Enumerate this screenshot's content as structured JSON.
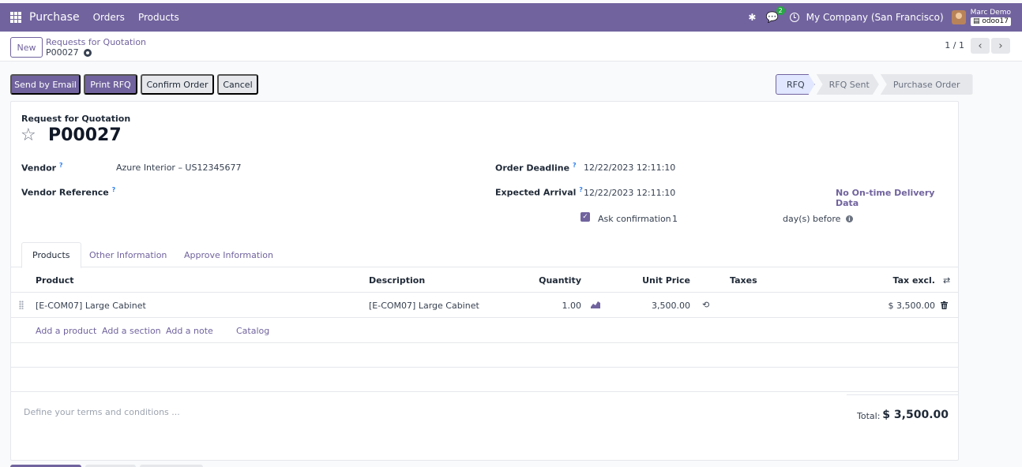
{
  "topnav": {
    "app_name": "Purchase",
    "menu": [
      "Orders",
      "Products"
    ],
    "chat_count": "2",
    "company": "My Company (San Francisco)",
    "user_name": "Marc Demo",
    "db_name": "odoo17"
  },
  "control": {
    "new_label": "New",
    "breadcrumb": "Requests for Quotation",
    "record": "P00027",
    "pager": "1 / 1"
  },
  "actions": {
    "send_email": "Send by Email",
    "print_rfq": "Print RFQ",
    "confirm_order": "Confirm Order",
    "cancel": "Cancel"
  },
  "statusbar": [
    "RFQ",
    "RFQ Sent",
    "Purchase Order"
  ],
  "form": {
    "doc_type": "Request for Quotation",
    "doc_name": "P00027",
    "vendor_label": "Vendor",
    "vendor_value": "Azure Interior – US12345677",
    "vendor_ref_label": "Vendor Reference",
    "deadline_label": "Order Deadline",
    "deadline_value": "12/22/2023 12:11:10",
    "arrival_label": "Expected Arrival",
    "arrival_value": "12/22/2023 12:11:10",
    "otd_link": "No On-time Delivery Data",
    "ask_confirm_label": "Ask confirmation",
    "ask_confirm_days": "1",
    "days_before": "day(s) before",
    "help_mark": "?"
  },
  "tabs": [
    "Products",
    "Other Information",
    "Approve Information"
  ],
  "table": {
    "headers": {
      "product": "Product",
      "description": "Description",
      "quantity": "Quantity",
      "unit_price": "Unit Price",
      "taxes": "Taxes",
      "subtotal": "Tax excl."
    },
    "rows": [
      {
        "product": "[E-COM07] Large Cabinet",
        "description": "[E-COM07] Large Cabinet",
        "quantity": "1.00",
        "unit_price": "3,500.00",
        "taxes": "",
        "subtotal": "$ 3,500.00"
      }
    ],
    "add_links": [
      "Add a product",
      "Add a section",
      "Add a note",
      "Catalog"
    ]
  },
  "footer": {
    "terms_placeholder": "Define your terms and conditions ...",
    "total_label": "Total:",
    "total_value": "$ 3,500.00"
  },
  "colors": {
    "brand": "#71639e",
    "help": "#2f80ed"
  }
}
